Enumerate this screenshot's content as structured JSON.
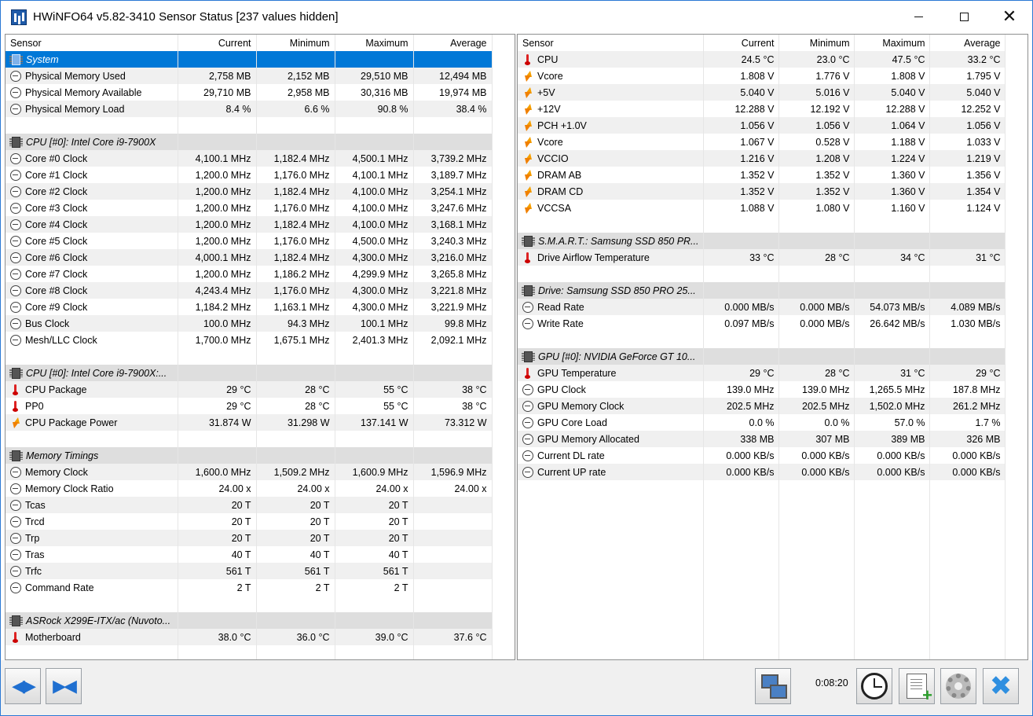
{
  "window": {
    "title": "HWiNFO64 v5.82-3410 Sensor Status [237 values hidden]"
  },
  "columns": [
    "Sensor",
    "Current",
    "Minimum",
    "Maximum",
    "Average"
  ],
  "left_rows": [
    {
      "type": "group",
      "label": "System",
      "selected": true
    },
    {
      "type": "data",
      "icon": "clock",
      "label": "Physical Memory Used",
      "cur": "2,758 MB",
      "min": "2,152 MB",
      "max": "29,510 MB",
      "avg": "12,494 MB"
    },
    {
      "type": "data",
      "icon": "clock",
      "label": "Physical Memory Available",
      "cur": "29,710 MB",
      "min": "2,958 MB",
      "max": "30,316 MB",
      "avg": "19,974 MB"
    },
    {
      "type": "data",
      "icon": "clock",
      "label": "Physical Memory Load",
      "cur": "8.4 %",
      "min": "6.6 %",
      "max": "90.8 %",
      "avg": "38.4 %"
    },
    {
      "type": "empty"
    },
    {
      "type": "group",
      "label": "CPU [#0]: Intel Core i9-7900X"
    },
    {
      "type": "data",
      "icon": "clock",
      "label": "Core #0 Clock",
      "cur": "4,100.1 MHz",
      "min": "1,182.4 MHz",
      "max": "4,500.1 MHz",
      "avg": "3,739.2 MHz"
    },
    {
      "type": "data",
      "icon": "clock",
      "label": "Core #1 Clock",
      "cur": "1,200.0 MHz",
      "min": "1,176.0 MHz",
      "max": "4,100.1 MHz",
      "avg": "3,189.7 MHz"
    },
    {
      "type": "data",
      "icon": "clock",
      "label": "Core #2 Clock",
      "cur": "1,200.0 MHz",
      "min": "1,182.4 MHz",
      "max": "4,100.0 MHz",
      "avg": "3,254.1 MHz"
    },
    {
      "type": "data",
      "icon": "clock",
      "label": "Core #3 Clock",
      "cur": "1,200.0 MHz",
      "min": "1,176.0 MHz",
      "max": "4,100.0 MHz",
      "avg": "3,247.6 MHz"
    },
    {
      "type": "data",
      "icon": "clock",
      "label": "Core #4 Clock",
      "cur": "1,200.0 MHz",
      "min": "1,182.4 MHz",
      "max": "4,100.0 MHz",
      "avg": "3,168.1 MHz"
    },
    {
      "type": "data",
      "icon": "clock",
      "label": "Core #5 Clock",
      "cur": "1,200.0 MHz",
      "min": "1,176.0 MHz",
      "max": "4,500.0 MHz",
      "avg": "3,240.3 MHz"
    },
    {
      "type": "data",
      "icon": "clock",
      "label": "Core #6 Clock",
      "cur": "4,000.1 MHz",
      "min": "1,182.4 MHz",
      "max": "4,300.0 MHz",
      "avg": "3,216.0 MHz"
    },
    {
      "type": "data",
      "icon": "clock",
      "label": "Core #7 Clock",
      "cur": "1,200.0 MHz",
      "min": "1,186.2 MHz",
      "max": "4,299.9 MHz",
      "avg": "3,265.8 MHz"
    },
    {
      "type": "data",
      "icon": "clock",
      "label": "Core #8 Clock",
      "cur": "4,243.4 MHz",
      "min": "1,176.0 MHz",
      "max": "4,300.0 MHz",
      "avg": "3,221.8 MHz"
    },
    {
      "type": "data",
      "icon": "clock",
      "label": "Core #9 Clock",
      "cur": "1,184.2 MHz",
      "min": "1,163.1 MHz",
      "max": "4,300.0 MHz",
      "avg": "3,221.9 MHz"
    },
    {
      "type": "data",
      "icon": "clock",
      "label": "Bus Clock",
      "cur": "100.0 MHz",
      "min": "94.3 MHz",
      "max": "100.1 MHz",
      "avg": "99.8 MHz"
    },
    {
      "type": "data",
      "icon": "clock",
      "label": "Mesh/LLC Clock",
      "cur": "1,700.0 MHz",
      "min": "1,675.1 MHz",
      "max": "2,401.3 MHz",
      "avg": "2,092.1 MHz"
    },
    {
      "type": "empty"
    },
    {
      "type": "group",
      "label": "CPU [#0]: Intel Core i9-7900X:..."
    },
    {
      "type": "data",
      "icon": "therm",
      "label": "CPU Package",
      "cur": "29 °C",
      "min": "28 °C",
      "max": "55 °C",
      "avg": "38 °C"
    },
    {
      "type": "data",
      "icon": "therm",
      "label": "PP0",
      "cur": "29 °C",
      "min": "28 °C",
      "max": "55 °C",
      "avg": "38 °C"
    },
    {
      "type": "data",
      "icon": "volt",
      "label": "CPU Package Power",
      "cur": "31.874 W",
      "min": "31.298 W",
      "max": "137.141 W",
      "avg": "73.312 W"
    },
    {
      "type": "empty"
    },
    {
      "type": "group",
      "label": "Memory Timings"
    },
    {
      "type": "data",
      "icon": "clock",
      "label": "Memory Clock",
      "cur": "1,600.0 MHz",
      "min": "1,509.2 MHz",
      "max": "1,600.9 MHz",
      "avg": "1,596.9 MHz"
    },
    {
      "type": "data",
      "icon": "clock",
      "label": "Memory Clock Ratio",
      "cur": "24.00 x",
      "min": "24.00 x",
      "max": "24.00 x",
      "avg": "24.00 x"
    },
    {
      "type": "data",
      "icon": "clock",
      "label": "Tcas",
      "cur": "20 T",
      "min": "20 T",
      "max": "20 T",
      "avg": ""
    },
    {
      "type": "data",
      "icon": "clock",
      "label": "Trcd",
      "cur": "20 T",
      "min": "20 T",
      "max": "20 T",
      "avg": ""
    },
    {
      "type": "data",
      "icon": "clock",
      "label": "Trp",
      "cur": "20 T",
      "min": "20 T",
      "max": "20 T",
      "avg": ""
    },
    {
      "type": "data",
      "icon": "clock",
      "label": "Tras",
      "cur": "40 T",
      "min": "40 T",
      "max": "40 T",
      "avg": ""
    },
    {
      "type": "data",
      "icon": "clock",
      "label": "Trfc",
      "cur": "561 T",
      "min": "561 T",
      "max": "561 T",
      "avg": ""
    },
    {
      "type": "data",
      "icon": "clock",
      "label": "Command Rate",
      "cur": "2 T",
      "min": "2 T",
      "max": "2 T",
      "avg": ""
    },
    {
      "type": "empty"
    },
    {
      "type": "group",
      "label": "ASRock X299E-ITX/ac (Nuvoto..."
    },
    {
      "type": "data",
      "icon": "therm",
      "label": "Motherboard",
      "cur": "38.0 °C",
      "min": "36.0 °C",
      "max": "39.0 °C",
      "avg": "37.6 °C"
    },
    {
      "type": "empty"
    }
  ],
  "right_rows": [
    {
      "type": "data",
      "icon": "therm",
      "label": "CPU",
      "cur": "24.5 °C",
      "min": "23.0 °C",
      "max": "47.5 °C",
      "avg": "33.2 °C"
    },
    {
      "type": "data",
      "icon": "volt",
      "label": "Vcore",
      "cur": "1.808 V",
      "min": "1.776 V",
      "max": "1.808 V",
      "avg": "1.795 V"
    },
    {
      "type": "data",
      "icon": "volt",
      "label": "+5V",
      "cur": "5.040 V",
      "min": "5.016 V",
      "max": "5.040 V",
      "avg": "5.040 V"
    },
    {
      "type": "data",
      "icon": "volt",
      "label": "+12V",
      "cur": "12.288 V",
      "min": "12.192 V",
      "max": "12.288 V",
      "avg": "12.252 V"
    },
    {
      "type": "data",
      "icon": "volt",
      "label": "PCH +1.0V",
      "cur": "1.056 V",
      "min": "1.056 V",
      "max": "1.064 V",
      "avg": "1.056 V"
    },
    {
      "type": "data",
      "icon": "volt",
      "label": "Vcore",
      "cur": "1.067 V",
      "min": "0.528 V",
      "max": "1.188 V",
      "avg": "1.033 V"
    },
    {
      "type": "data",
      "icon": "volt",
      "label": "VCCIO",
      "cur": "1.216 V",
      "min": "1.208 V",
      "max": "1.224 V",
      "avg": "1.219 V"
    },
    {
      "type": "data",
      "icon": "volt",
      "label": "DRAM AB",
      "cur": "1.352 V",
      "min": "1.352 V",
      "max": "1.360 V",
      "avg": "1.356 V"
    },
    {
      "type": "data",
      "icon": "volt",
      "label": "DRAM CD",
      "cur": "1.352 V",
      "min": "1.352 V",
      "max": "1.360 V",
      "avg": "1.354 V"
    },
    {
      "type": "data",
      "icon": "volt",
      "label": "VCCSA",
      "cur": "1.088 V",
      "min": "1.080 V",
      "max": "1.160 V",
      "avg": "1.124 V"
    },
    {
      "type": "empty"
    },
    {
      "type": "group",
      "label": "S.M.A.R.T.: Samsung SSD 850 PR..."
    },
    {
      "type": "data",
      "icon": "therm",
      "label": "Drive Airflow Temperature",
      "cur": "33 °C",
      "min": "28 °C",
      "max": "34 °C",
      "avg": "31 °C"
    },
    {
      "type": "empty"
    },
    {
      "type": "group",
      "label": "Drive: Samsung SSD 850 PRO 25..."
    },
    {
      "type": "data",
      "icon": "clock",
      "label": "Read Rate",
      "cur": "0.000 MB/s",
      "min": "0.000 MB/s",
      "max": "54.073 MB/s",
      "avg": "4.089 MB/s"
    },
    {
      "type": "data",
      "icon": "clock",
      "label": "Write Rate",
      "cur": "0.097 MB/s",
      "min": "0.000 MB/s",
      "max": "26.642 MB/s",
      "avg": "1.030 MB/s"
    },
    {
      "type": "empty"
    },
    {
      "type": "group",
      "label": "GPU [#0]: NVIDIA GeForce GT 10..."
    },
    {
      "type": "data",
      "icon": "therm",
      "label": "GPU Temperature",
      "cur": "29 °C",
      "min": "28 °C",
      "max": "31 °C",
      "avg": "29 °C"
    },
    {
      "type": "data",
      "icon": "clock",
      "label": "GPU Clock",
      "cur": "139.0 MHz",
      "min": "139.0 MHz",
      "max": "1,265.5 MHz",
      "avg": "187.8 MHz"
    },
    {
      "type": "data",
      "icon": "clock",
      "label": "GPU Memory Clock",
      "cur": "202.5 MHz",
      "min": "202.5 MHz",
      "max": "1,502.0 MHz",
      "avg": "261.2 MHz"
    },
    {
      "type": "data",
      "icon": "clock",
      "label": "GPU Core Load",
      "cur": "0.0 %",
      "min": "0.0 %",
      "max": "57.0 %",
      "avg": "1.7 %"
    },
    {
      "type": "data",
      "icon": "clock",
      "label": "GPU Memory Allocated",
      "cur": "338 MB",
      "min": "307 MB",
      "max": "389 MB",
      "avg": "326 MB"
    },
    {
      "type": "data",
      "icon": "clock",
      "label": "Current DL rate",
      "cur": "0.000 KB/s",
      "min": "0.000 KB/s",
      "max": "0.000 KB/s",
      "avg": "0.000 KB/s"
    },
    {
      "type": "data",
      "icon": "clock",
      "label": "Current UP rate",
      "cur": "0.000 KB/s",
      "min": "0.000 KB/s",
      "max": "0.000 KB/s",
      "avg": "0.000 KB/s"
    },
    {
      "type": "empty"
    },
    {
      "type": "empty"
    },
    {
      "type": "empty"
    },
    {
      "type": "empty"
    },
    {
      "type": "empty"
    },
    {
      "type": "empty"
    },
    {
      "type": "empty"
    },
    {
      "type": "empty"
    },
    {
      "type": "empty"
    },
    {
      "type": "empty"
    },
    {
      "type": "empty"
    }
  ],
  "statusbar": {
    "timer": "0:08:20",
    "icons": {
      "expand": "expand-arrows-icon",
      "collapse": "collapse-arrows-icon",
      "network": "network-icon",
      "clock": "clock-reset-icon",
      "log": "add-log-icon",
      "settings": "gear-icon",
      "close": "close-icon"
    }
  },
  "colors": {
    "selection": "#0078d7",
    "group_row": "#dedede",
    "alt_row": "#f0f0f0",
    "window_border": "#2b79d4"
  }
}
